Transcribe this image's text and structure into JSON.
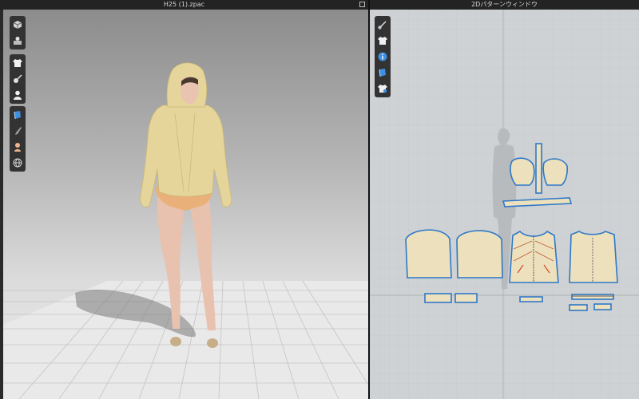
{
  "window3d": {
    "title": "H25 (1).zpac",
    "toolbar_groups": [
      [
        "cube-icon",
        "avatar-stack-icon"
      ],
      [
        "shirt-icon",
        "garment-tools-icon",
        "avatar-icon"
      ],
      [
        "fabric-icon",
        "brush-icon",
        "skin-icon",
        "globe-icon"
      ]
    ]
  },
  "window2d": {
    "title": "2Dパターンウィンドウ",
    "toolbar_items": [
      "scissors-icon",
      "shirt-icon",
      "info-icon",
      "fabric-icon",
      "shirt-settings-icon"
    ]
  },
  "colors": {
    "pattern_fill": "#ede1bd",
    "pattern_outline": "#2e78c8",
    "garment": "#e6d59a",
    "grid2d": "#b9bcbf"
  }
}
